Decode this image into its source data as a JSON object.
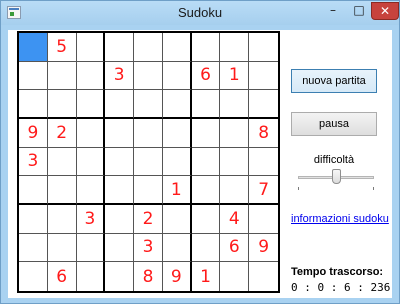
{
  "window": {
    "title": "Sudoku"
  },
  "titlebar": {
    "minimize": "–",
    "maximize": "□",
    "close": "✕"
  },
  "grid": {
    "rows": [
      [
        "",
        "5",
        "",
        "",
        "",
        "",
        "",
        "",
        ""
      ],
      [
        "",
        "",
        "",
        "3",
        "",
        "",
        "6",
        "1",
        ""
      ],
      [
        "",
        "",
        "",
        "",
        "",
        "",
        "",
        "",
        ""
      ],
      [
        "9",
        "2",
        "",
        "",
        "",
        "",
        "",
        "",
        "8"
      ],
      [
        "3",
        "",
        "",
        "",
        "",
        "",
        "",
        "",
        ""
      ],
      [
        "",
        "",
        "",
        "",
        "",
        "1",
        "",
        "",
        "7"
      ],
      [
        "",
        "",
        "3",
        "",
        "2",
        "",
        "",
        "4",
        ""
      ],
      [
        "",
        "",
        "",
        "",
        "3",
        "",
        "",
        "6",
        "9"
      ],
      [
        "",
        "6",
        "",
        "",
        "8",
        "9",
        "1",
        "",
        ""
      ]
    ],
    "selected_cell": {
      "row": 0,
      "col": 0
    },
    "digit_color": "#ff1a1a",
    "selection_color": "#3d93f2"
  },
  "controls": {
    "new_game_label": "nuova partita",
    "pause_label": "pausa",
    "difficulty_label": "difficoltà",
    "difficulty_level": 0.5,
    "info_link": "informazioni sudoku",
    "elapsed_label": "Tempo trascorso:",
    "elapsed_value": "0 : 0 : 6 : 236"
  }
}
